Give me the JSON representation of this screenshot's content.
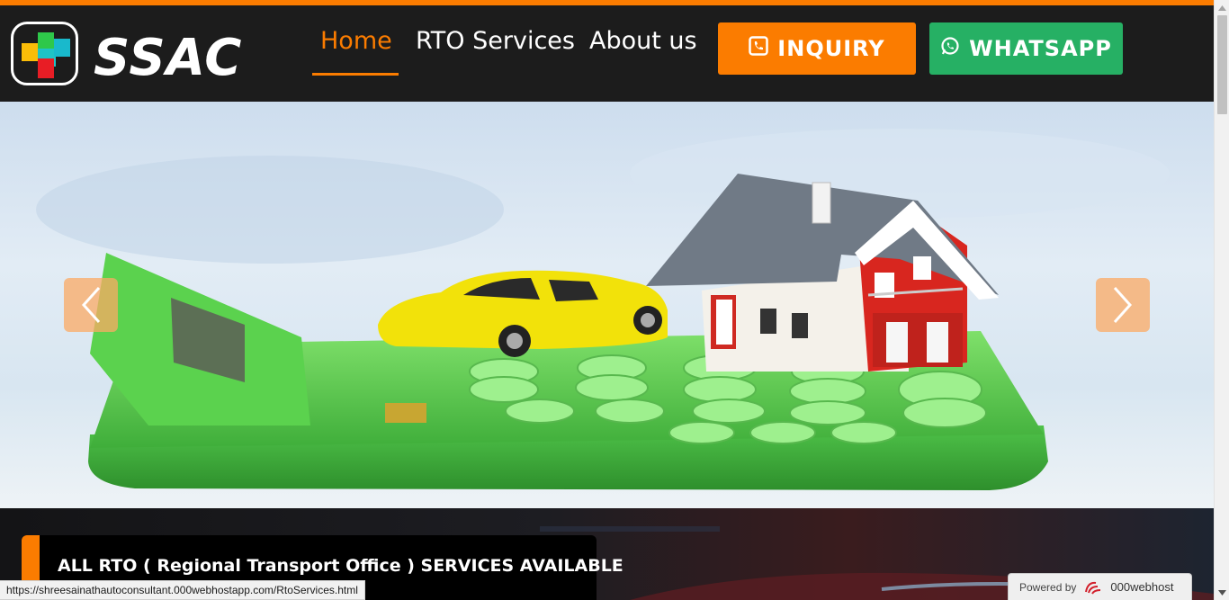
{
  "brand": {
    "logo_text": "SSAC",
    "logo_icon": "colored-blocks-logo-icon"
  },
  "nav": {
    "items": [
      {
        "label": "Home",
        "active": true
      },
      {
        "label": "RTO Services",
        "active": false
      },
      {
        "label": "About us",
        "active": false
      }
    ]
  },
  "actions": {
    "inquiry_label": "INQUIRY",
    "inquiry_icon": "phone-icon",
    "whatsapp_label": "WHATSAPP",
    "whatsapp_icon": "whatsapp-icon"
  },
  "hero": {
    "prev_icon": "chevron-left-icon",
    "next_icon": "chevron-right-icon"
  },
  "banner": {
    "text": "ALL RTO ( Regional Transport Office ) SERVICES AVAILABLE"
  },
  "status_bar": {
    "url": "https://shreesainathautoconsultant.000webhostapp.com/RtoServices.html"
  },
  "footer_badge": {
    "prefix": "Powered by",
    "brand": "000webhost"
  },
  "colors": {
    "accent": "#fb7c00",
    "whatsapp": "#26b064",
    "header_bg": "#1c1c1c"
  }
}
